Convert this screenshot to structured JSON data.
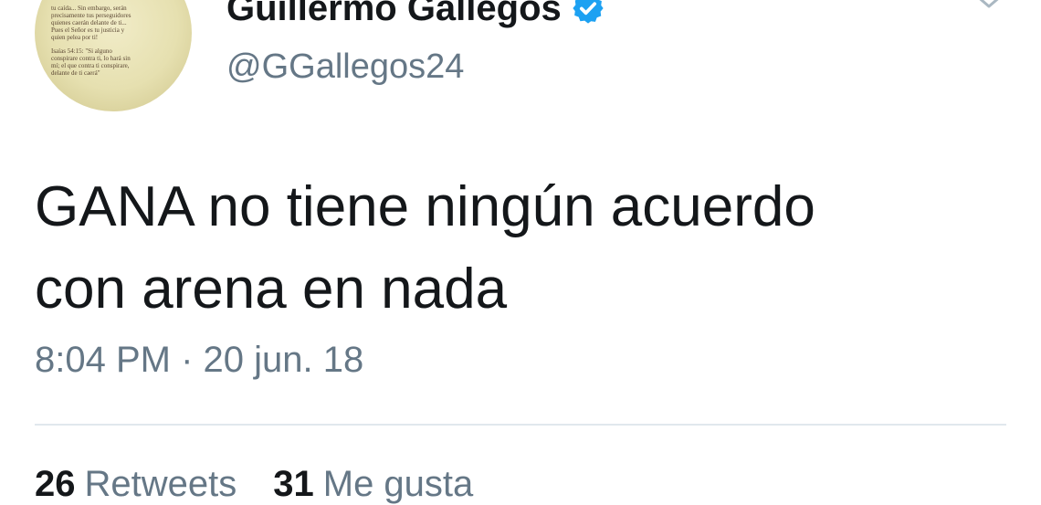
{
  "avatar": {
    "quote_top": [
      "tu caída... Sin embargo, serán",
      "precisamente tus perseguidores",
      "quienes caerán delante de ti...",
      "Pues el Señor es tu justicia y",
      "quien pelea por ti!"
    ],
    "quote_bottom": [
      "Isaías 54:15: \"Si alguno",
      "conspirare contra ti, lo hará sin",
      "mí; el que contra ti conspirare,",
      "delante de ti caerá\""
    ]
  },
  "header": {
    "display_name": "Guillermo Gallegos",
    "handle": "@GGallegos24",
    "verified_icon": "verified-badge-icon",
    "menu_icon": "chevron-down-icon",
    "accent_color": "#1da1f2"
  },
  "tweet": {
    "lines": [
      "GANA no tiene ningún acuerdo",
      "con arena en nada"
    ],
    "time": "8:04 PM",
    "separator": "·",
    "date": "20 jun. 18"
  },
  "stats": {
    "retweets_count": "26",
    "retweets_label": "Retweets",
    "likes_count": "31",
    "likes_label": "Me gusta"
  }
}
